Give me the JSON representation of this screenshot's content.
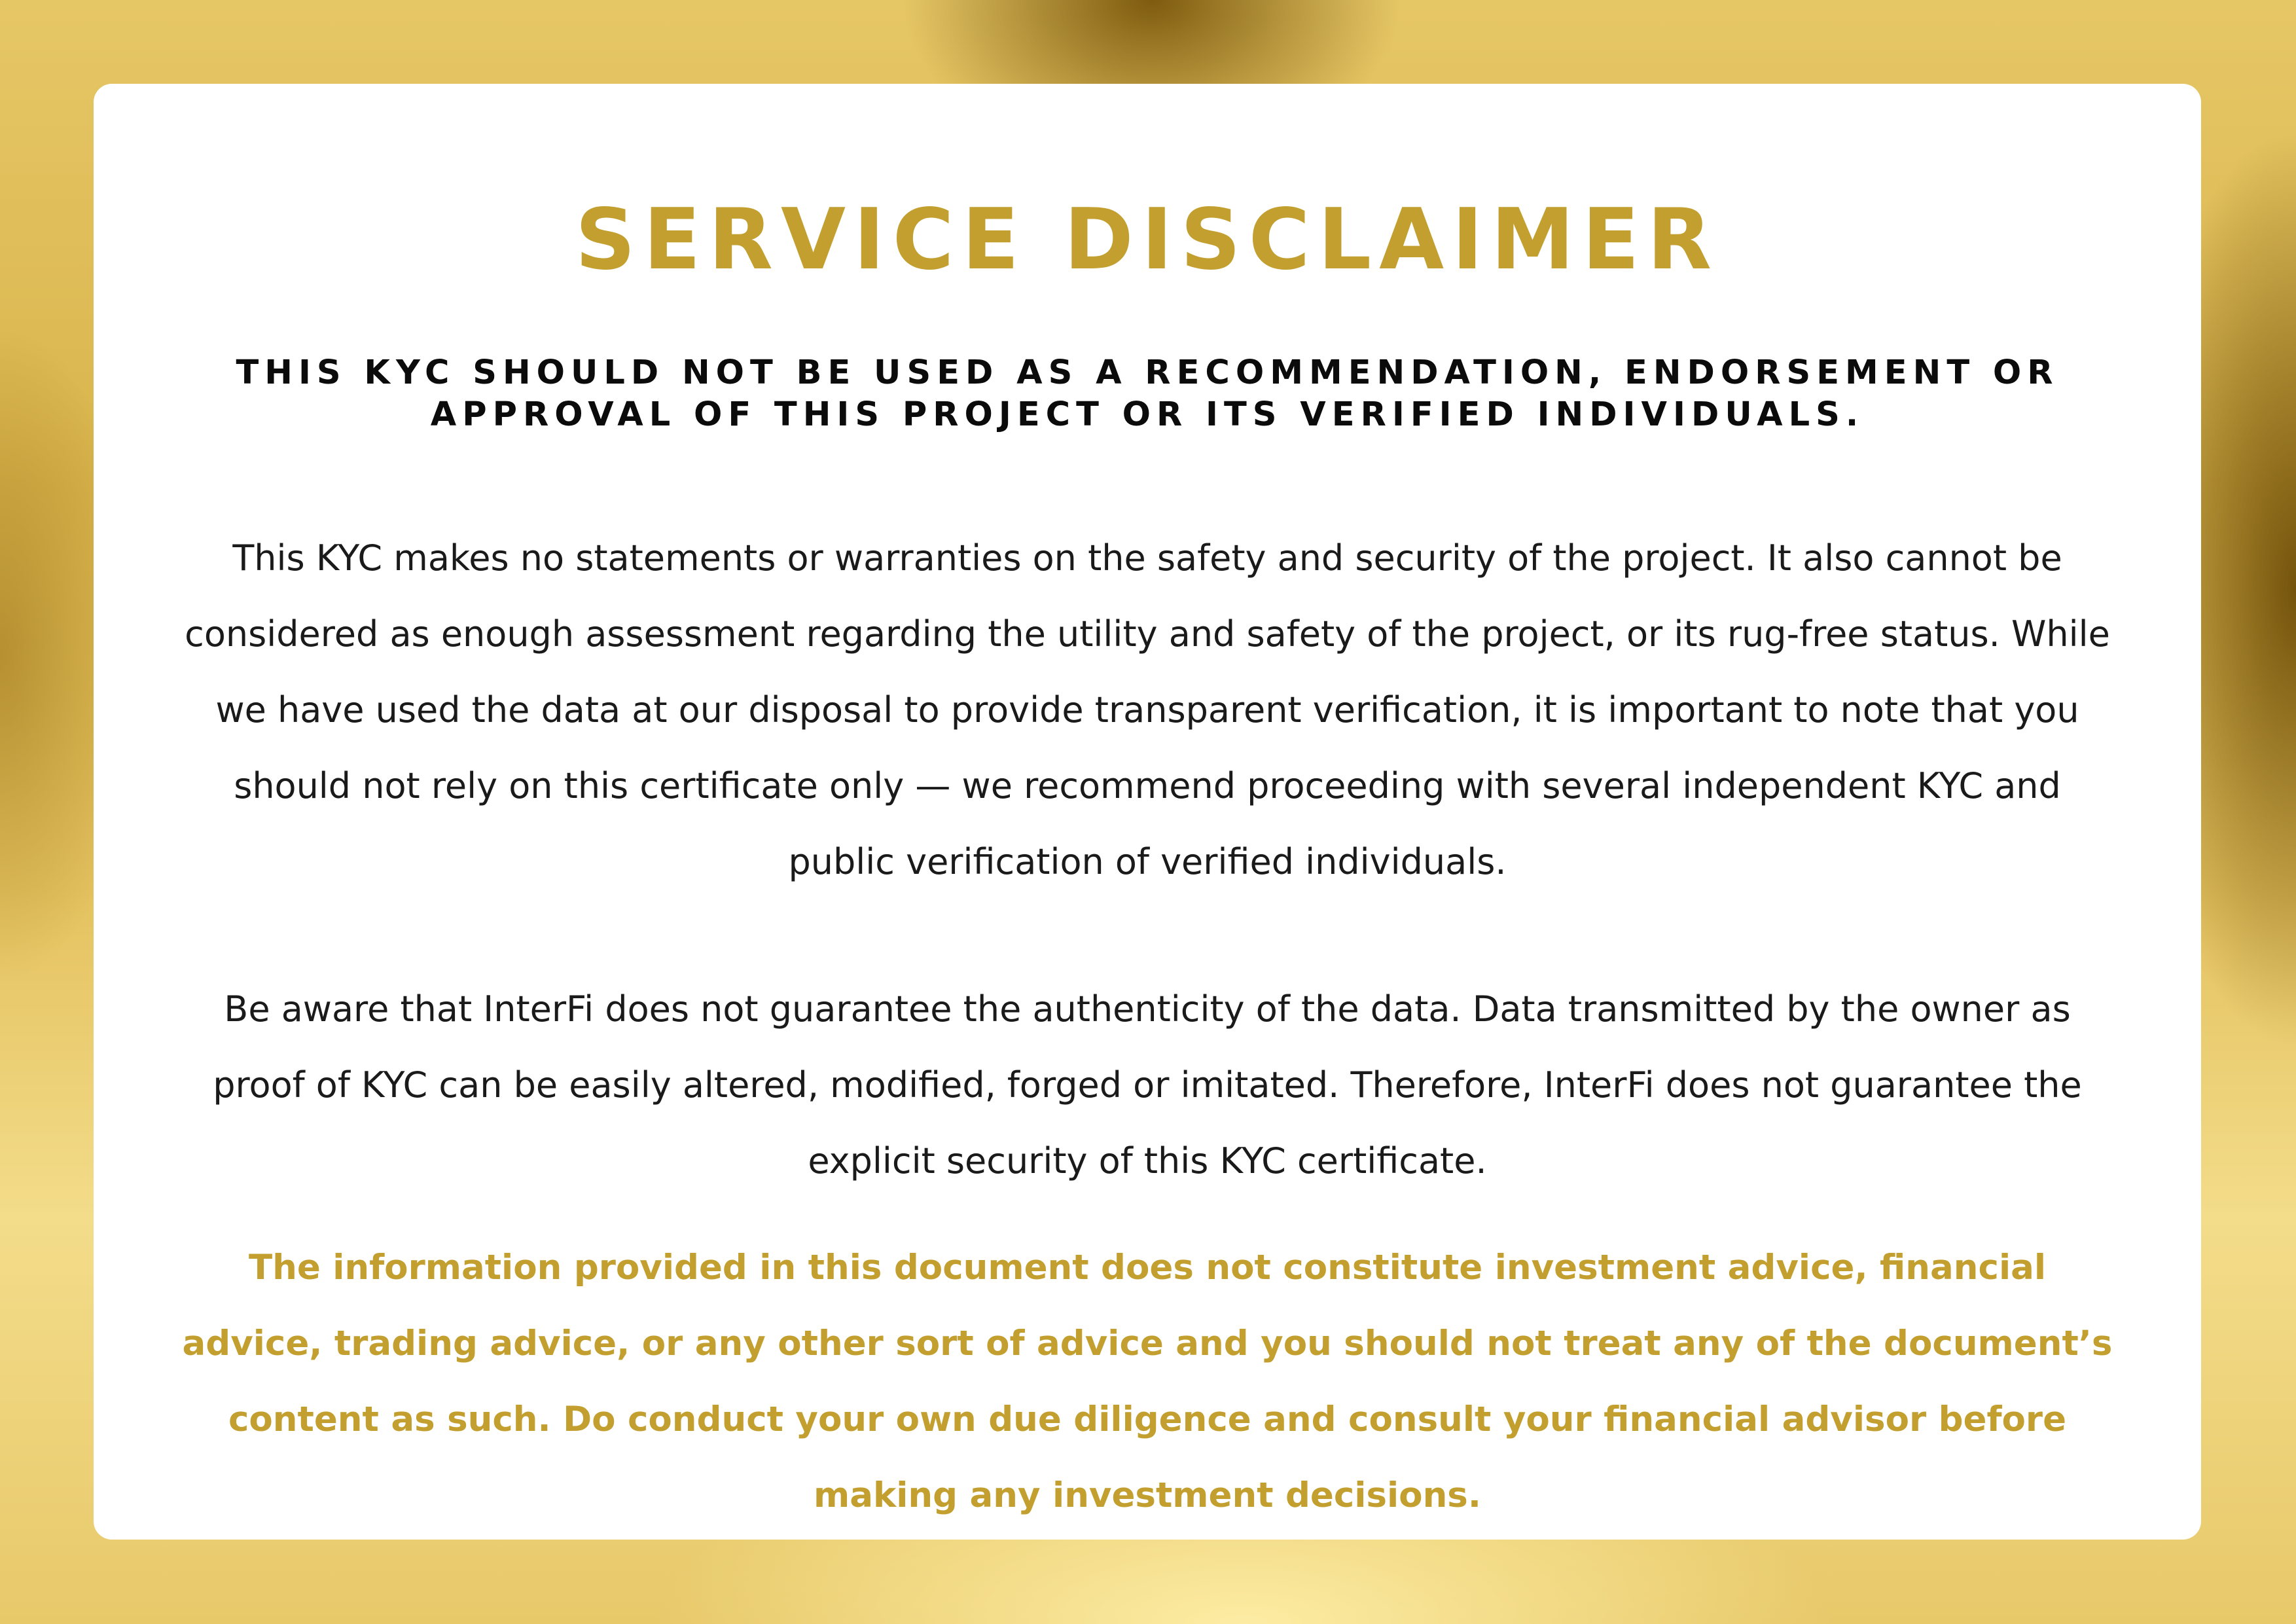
{
  "disclaimer": {
    "title": "SERVICE DISCLAIMER",
    "subtitle": "THIS KYC SHOULD NOT BE USED AS A RECOMMENDATION, ENDORSEMENT OR APPROVAL OF THIS PROJECT OR ITS VERIFIED INDIVIDUALS.",
    "paragraph_1": "This KYC makes no statements or warranties on the safety and security of the project. It also cannot be considered as enough assessment regarding the utility and safety of the project, or its rug-free status. While we have used the data at our disposal to provide transparent verification, it is important to note that you should not rely on this certificate only — we recommend proceeding with several independent KYC and public verification of verified individuals.",
    "paragraph_2": "Be aware that InterFi does not guarantee the authenticity of the data. Data transmitted by the owner as proof of KYC can be easily altered, modified, forged or imitated. Therefore, InterFi does not guarantee the explicit security of this KYC certificate.",
    "paragraph_3": "The information provided in this document does not constitute investment advice, financial advice, trading advice, or any other sort of advice and you should not treat any of the document’s content as such. Do conduct your own due diligence and consult your financial advisor before making any investment decisions."
  },
  "colors": {
    "accent_gold": "#c29f2e",
    "text_dark": "#1a1a1a",
    "card_background": "#ffffff"
  }
}
